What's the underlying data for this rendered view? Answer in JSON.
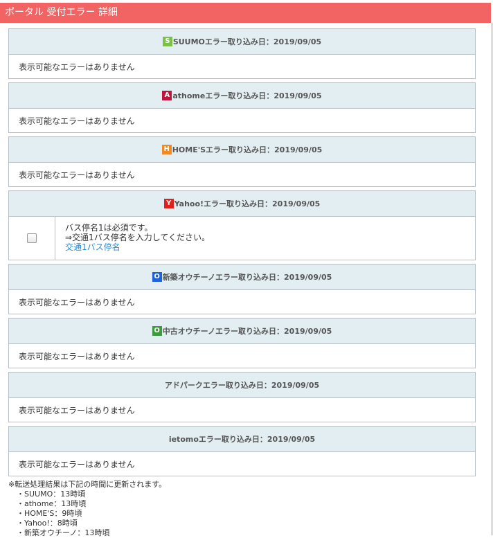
{
  "window": {
    "title": "ポータル 受付エラー 詳細"
  },
  "sections": [
    {
      "badge": "S",
      "badge_color": "#7cc04a",
      "title": "SUUMOエラー取り込み日：2019/09/05",
      "message": "表示可能なエラーはありません"
    },
    {
      "badge": "A",
      "badge_color": "#c0143c",
      "title": "athomeエラー取り込み日：2019/09/05",
      "message": "表示可能なエラーはありません"
    },
    {
      "badge": "H",
      "badge_color": "#f08a24",
      "title": "HOME'Sエラー取り込み日：2019/09/05",
      "message": "表示可能なエラーはありません"
    },
    {
      "badge": "Y",
      "badge_color": "#e0201c",
      "title": "Yahoo!エラー取り込み日：2019/09/05"
    },
    {
      "badge": "O",
      "badge_color": "#1e63d8",
      "title": "新築オウチーノエラー取り込み日：2019/09/05",
      "message": "表示可能なエラーはありません"
    },
    {
      "badge": "O",
      "badge_color": "#3c9b3c",
      "title": "中古オウチーノエラー取り込み日：2019/09/05",
      "message": "表示可能なエラーはありません"
    },
    {
      "title": "アドパークエラー取り込み日：2019/09/05",
      "message": "表示可能なエラーはありません"
    },
    {
      "title": "ietomoエラー取り込み日：2019/09/05",
      "message": "表示可能なエラーはありません"
    }
  ],
  "yahoo_error": {
    "line1": "バス停名1は必須です。",
    "line2": "⇒交通1バス停名を入力してください。",
    "link": "交通1バス停名"
  },
  "notes": {
    "header": "※転送処理結果は下記の時間に更新されます。",
    "items": [
      "・SUUMO：13時頃",
      "・athome：13時頃",
      "・HOME'S：9時頃",
      "・Yahoo!：8時頃",
      "・新築オウチーノ：13時頃"
    ]
  }
}
